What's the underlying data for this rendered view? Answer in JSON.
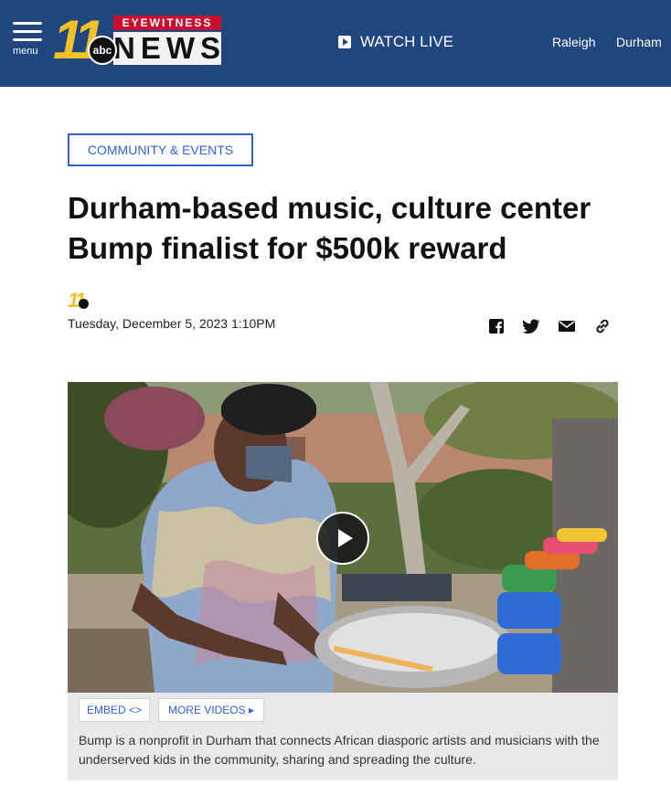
{
  "header": {
    "menu_label": "menu",
    "logo": {
      "number": "11",
      "network": "abc",
      "top": "EYEWITNESS",
      "bottom": "NEWS"
    },
    "watch_live": "WATCH LIVE",
    "locations": [
      "Raleigh",
      "Durham"
    ]
  },
  "article": {
    "category": "COMMUNITY & EVENTS",
    "headline_line1": "Durham-based music, culture center",
    "headline_line2": "Bump finalist for $500k reward",
    "dateline": "Tuesday, December 5, 2023 1:10PM",
    "share_icons": [
      "facebook-icon",
      "twitter-icon",
      "email-icon",
      "link-icon"
    ]
  },
  "video": {
    "embed_label": "EMBED <>",
    "more_label": "MORE VIDEOS ▸",
    "caption": "Bump is a nonprofit in Durham that connects African diasporic artists and musicians with the underserved kids in the community, sharing and spreading the culture."
  },
  "colors": {
    "header_bg": "#21457f",
    "accent_blue": "#2f62d6",
    "logo_yellow": "#f0c228",
    "logo_red": "#c8102e"
  }
}
